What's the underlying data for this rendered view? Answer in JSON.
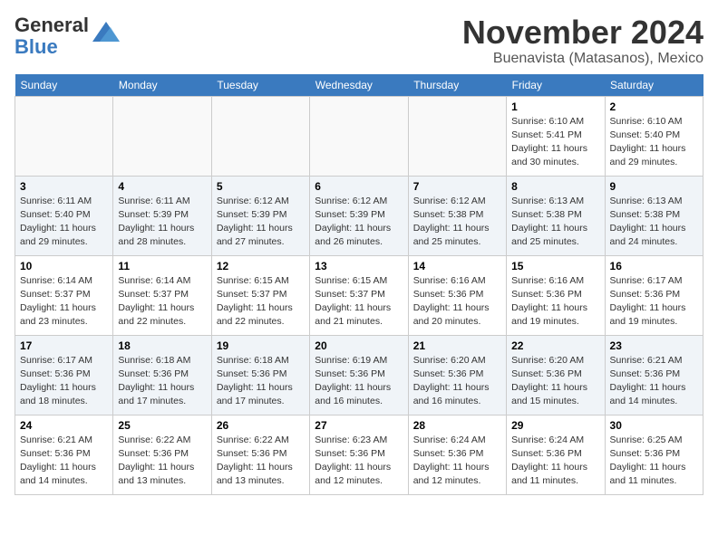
{
  "header": {
    "logo_general": "General",
    "logo_blue": "Blue",
    "month": "November 2024",
    "location": "Buenavista (Matasanos), Mexico"
  },
  "weekdays": [
    "Sunday",
    "Monday",
    "Tuesday",
    "Wednesday",
    "Thursday",
    "Friday",
    "Saturday"
  ],
  "weeks": [
    [
      {
        "day": null
      },
      {
        "day": null
      },
      {
        "day": null
      },
      {
        "day": null
      },
      {
        "day": null
      },
      {
        "day": "1",
        "sunrise": "6:10 AM",
        "sunset": "5:41 PM",
        "daylight": "11 hours and 30 minutes."
      },
      {
        "day": "2",
        "sunrise": "6:10 AM",
        "sunset": "5:40 PM",
        "daylight": "11 hours and 29 minutes."
      }
    ],
    [
      {
        "day": "3",
        "sunrise": "6:11 AM",
        "sunset": "5:40 PM",
        "daylight": "11 hours and 29 minutes."
      },
      {
        "day": "4",
        "sunrise": "6:11 AM",
        "sunset": "5:39 PM",
        "daylight": "11 hours and 28 minutes."
      },
      {
        "day": "5",
        "sunrise": "6:12 AM",
        "sunset": "5:39 PM",
        "daylight": "11 hours and 27 minutes."
      },
      {
        "day": "6",
        "sunrise": "6:12 AM",
        "sunset": "5:39 PM",
        "daylight": "11 hours and 26 minutes."
      },
      {
        "day": "7",
        "sunrise": "6:12 AM",
        "sunset": "5:38 PM",
        "daylight": "11 hours and 25 minutes."
      },
      {
        "day": "8",
        "sunrise": "6:13 AM",
        "sunset": "5:38 PM",
        "daylight": "11 hours and 25 minutes."
      },
      {
        "day": "9",
        "sunrise": "6:13 AM",
        "sunset": "5:38 PM",
        "daylight": "11 hours and 24 minutes."
      }
    ],
    [
      {
        "day": "10",
        "sunrise": "6:14 AM",
        "sunset": "5:37 PM",
        "daylight": "11 hours and 23 minutes."
      },
      {
        "day": "11",
        "sunrise": "6:14 AM",
        "sunset": "5:37 PM",
        "daylight": "11 hours and 22 minutes."
      },
      {
        "day": "12",
        "sunrise": "6:15 AM",
        "sunset": "5:37 PM",
        "daylight": "11 hours and 22 minutes."
      },
      {
        "day": "13",
        "sunrise": "6:15 AM",
        "sunset": "5:37 PM",
        "daylight": "11 hours and 21 minutes."
      },
      {
        "day": "14",
        "sunrise": "6:16 AM",
        "sunset": "5:36 PM",
        "daylight": "11 hours and 20 minutes."
      },
      {
        "day": "15",
        "sunrise": "6:16 AM",
        "sunset": "5:36 PM",
        "daylight": "11 hours and 19 minutes."
      },
      {
        "day": "16",
        "sunrise": "6:17 AM",
        "sunset": "5:36 PM",
        "daylight": "11 hours and 19 minutes."
      }
    ],
    [
      {
        "day": "17",
        "sunrise": "6:17 AM",
        "sunset": "5:36 PM",
        "daylight": "11 hours and 18 minutes."
      },
      {
        "day": "18",
        "sunrise": "6:18 AM",
        "sunset": "5:36 PM",
        "daylight": "11 hours and 17 minutes."
      },
      {
        "day": "19",
        "sunrise": "6:18 AM",
        "sunset": "5:36 PM",
        "daylight": "11 hours and 17 minutes."
      },
      {
        "day": "20",
        "sunrise": "6:19 AM",
        "sunset": "5:36 PM",
        "daylight": "11 hours and 16 minutes."
      },
      {
        "day": "21",
        "sunrise": "6:20 AM",
        "sunset": "5:36 PM",
        "daylight": "11 hours and 16 minutes."
      },
      {
        "day": "22",
        "sunrise": "6:20 AM",
        "sunset": "5:36 PM",
        "daylight": "11 hours and 15 minutes."
      },
      {
        "day": "23",
        "sunrise": "6:21 AM",
        "sunset": "5:36 PM",
        "daylight": "11 hours and 14 minutes."
      }
    ],
    [
      {
        "day": "24",
        "sunrise": "6:21 AM",
        "sunset": "5:36 PM",
        "daylight": "11 hours and 14 minutes."
      },
      {
        "day": "25",
        "sunrise": "6:22 AM",
        "sunset": "5:36 PM",
        "daylight": "11 hours and 13 minutes."
      },
      {
        "day": "26",
        "sunrise": "6:22 AM",
        "sunset": "5:36 PM",
        "daylight": "11 hours and 13 minutes."
      },
      {
        "day": "27",
        "sunrise": "6:23 AM",
        "sunset": "5:36 PM",
        "daylight": "11 hours and 12 minutes."
      },
      {
        "day": "28",
        "sunrise": "6:24 AM",
        "sunset": "5:36 PM",
        "daylight": "11 hours and 12 minutes."
      },
      {
        "day": "29",
        "sunrise": "6:24 AM",
        "sunset": "5:36 PM",
        "daylight": "11 hours and 11 minutes."
      },
      {
        "day": "30",
        "sunrise": "6:25 AM",
        "sunset": "5:36 PM",
        "daylight": "11 hours and 11 minutes."
      }
    ]
  ]
}
